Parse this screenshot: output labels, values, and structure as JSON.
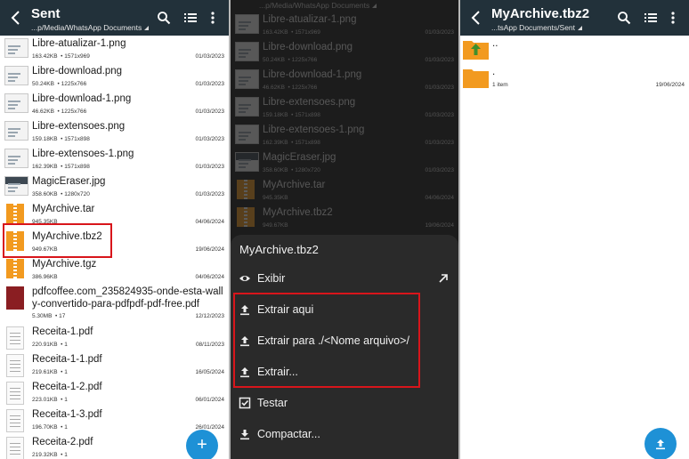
{
  "left": {
    "title": "Sent",
    "path": "...p/Media/WhatsApp Documents",
    "files": [
      {
        "name": "Libre-atualizar-1.png",
        "size": "163.42KB",
        "dims": "1571x969",
        "date": "01/03/2023",
        "kind": "image"
      },
      {
        "name": "Libre-download.png",
        "size": "50.24KB",
        "dims": "1225x766",
        "date": "01/03/2023",
        "kind": "image"
      },
      {
        "name": "Libre-download-1.png",
        "size": "46.62KB",
        "dims": "1225x766",
        "date": "01/03/2023",
        "kind": "image"
      },
      {
        "name": "Libre-extensoes.png",
        "size": "159.18KB",
        "dims": "1571x898",
        "date": "01/03/2023",
        "kind": "image"
      },
      {
        "name": "Libre-extensoes-1.png",
        "size": "162.39KB",
        "dims": "1571x898",
        "date": "01/03/2023",
        "kind": "image"
      },
      {
        "name": "MagicEraser.jpg",
        "size": "358.60KB",
        "dims": "1280x720",
        "date": "01/03/2023",
        "kind": "image-dark"
      },
      {
        "name": "MyArchive.tar",
        "size": "945.35KB",
        "dims": "",
        "date": "04/06/2024",
        "kind": "archive"
      },
      {
        "name": "MyArchive.tbz2",
        "size": "949.67KB",
        "dims": "",
        "date": "19/06/2024",
        "kind": "archive"
      },
      {
        "name": "MyArchive.tgz",
        "size": "386.96KB",
        "dims": "",
        "date": "04/06/2024",
        "kind": "archive"
      },
      {
        "name": "pdfcoffee.com_235824935-onde-esta-wall",
        "name2": "y-convertido-para-pdfpdf-pdf-free.pdf",
        "size": "5.30MB",
        "dims": "17",
        "date": "12/12/2023",
        "kind": "book"
      },
      {
        "name": "Receita-1.pdf",
        "size": "220.91KB",
        "dims": "1",
        "date": "08/11/2023",
        "kind": "pdf"
      },
      {
        "name": "Receita-1-1.pdf",
        "size": "219.61KB",
        "dims": "1",
        "date": "16/05/2024",
        "kind": "pdf"
      },
      {
        "name": "Receita-1-2.pdf",
        "size": "223.01KB",
        "dims": "1",
        "date": "06/01/2024",
        "kind": "pdf"
      },
      {
        "name": "Receita-1-3.pdf",
        "size": "196.70KB",
        "dims": "1",
        "date": "26/01/2024",
        "kind": "pdf"
      },
      {
        "name": "Receita-2.pdf",
        "size": "219.32KB",
        "dims": "1",
        "date": "",
        "kind": "pdf"
      }
    ],
    "fab_icon": "+"
  },
  "middle": {
    "path": "...p/Media/WhatsApp Documents",
    "files": [
      {
        "name": "Libre-atualizar-1.png",
        "size": "163.42KB",
        "dims": "1571x969",
        "date": "01/03/2023",
        "kind": "image"
      },
      {
        "name": "Libre-download.png",
        "size": "50.24KB",
        "dims": "1225x766",
        "date": "01/03/2023",
        "kind": "image"
      },
      {
        "name": "Libre-download-1.png",
        "size": "46.62KB",
        "dims": "1225x766",
        "date": "01/03/2023",
        "kind": "image"
      },
      {
        "name": "Libre-extensoes.png",
        "size": "159.18KB",
        "dims": "1571x898",
        "date": "01/03/2023",
        "kind": "image"
      },
      {
        "name": "Libre-extensoes-1.png",
        "size": "162.39KB",
        "dims": "1571x898",
        "date": "01/03/2023",
        "kind": "image"
      },
      {
        "name": "MagicEraser.jpg",
        "size": "358.60KB",
        "dims": "1280x720",
        "date": "01/03/2023",
        "kind": "image-dark"
      },
      {
        "name": "MyArchive.tar",
        "size": "945.35KB",
        "dims": "",
        "date": "04/06/2024",
        "kind": "archive"
      },
      {
        "name": "MyArchive.tbz2",
        "size": "949.67KB",
        "dims": "",
        "date": "19/06/2024",
        "kind": "archive"
      }
    ],
    "sheet": {
      "title": "MyArchive.tbz2",
      "items": [
        {
          "label": "Exibir",
          "icon": "eye-icon"
        },
        {
          "label": "Extrair aqui",
          "icon": "upload-icon"
        },
        {
          "label": "Extrair para ./<Nome arquivo>/",
          "icon": "upload-icon"
        },
        {
          "label": "Extrair...",
          "icon": "upload-icon"
        },
        {
          "label": "Testar",
          "icon": "checkbox-icon"
        },
        {
          "label": "Compactar...",
          "icon": "download-icon"
        }
      ]
    }
  },
  "right": {
    "title": "MyArchive.tbz2",
    "path": "...tsApp Documents/Sent",
    "folders": [
      {
        "name": "..",
        "meta": "",
        "date": "",
        "icon": "up-folder-icon"
      },
      {
        "name": ".",
        "meta": "1 item",
        "date": "19/06/2024",
        "icon": "folder-icon"
      }
    ]
  },
  "colors": {
    "topbar": "#22313a",
    "accent": "#1e91d6",
    "highlight": "#d8151b",
    "folder": "#f29a1f"
  }
}
